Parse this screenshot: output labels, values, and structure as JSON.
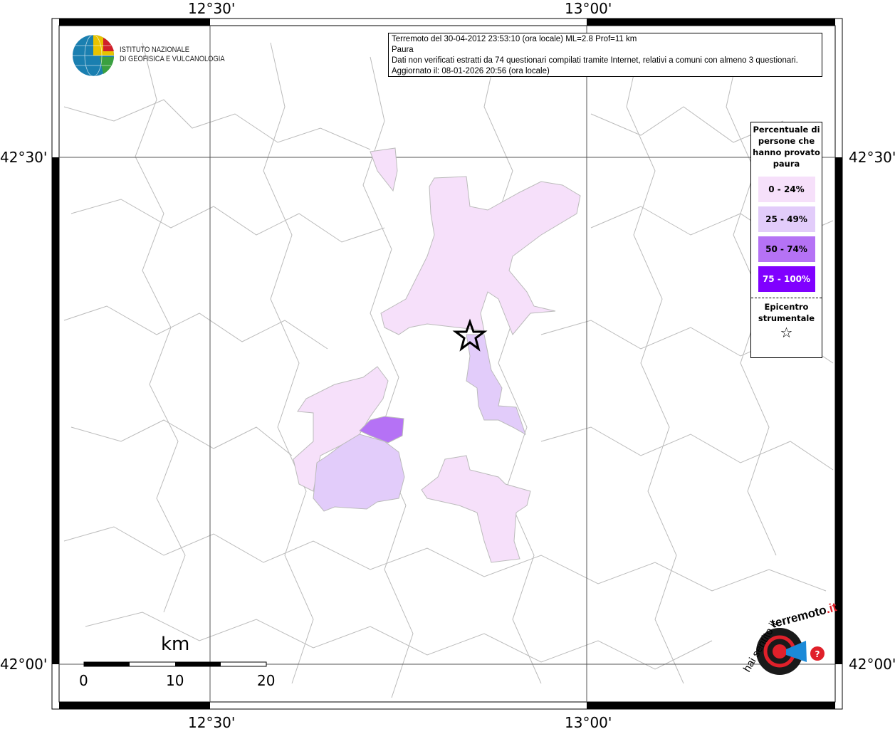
{
  "info": {
    "line1": "Terremoto del 30-04-2012 23:53:10 (ora locale) ML=2.8 Prof=11 km",
    "line2": "Paura",
    "line3": "Dati non verificati estratti da 74 questionari compilati tramite Internet, relativi a comuni con almeno 3 questionari.",
    "line4": "Aggiornato il: 08-01-2026 20:56 (ora locale)"
  },
  "logo": {
    "line1": "ISTITUTO NAZIONALE",
    "line2": "DI GEOFISICA E VULCANOLOGIA"
  },
  "axes": {
    "top": [
      "12°30'",
      "13°00'"
    ],
    "bottom": [
      "12°30'",
      "13°00'"
    ],
    "left": [
      "42°30'",
      "42°00'"
    ],
    "right": [
      "42°30'",
      "42°00'"
    ]
  },
  "legend": {
    "title": "Percentuale di persone che hanno provato paura",
    "classes": [
      {
        "label": "0 - 24%",
        "color": "#f6e0fa"
      },
      {
        "label": "25 - 49%",
        "color": "#e2ccfa"
      },
      {
        "label": "50 - 74%",
        "color": "#b572f5"
      },
      {
        "label": "75 - 100%",
        "color": "#8000ff"
      }
    ],
    "epicenter_label": "Epicentro strumentale",
    "epicenter_symbol": "☆"
  },
  "scale": {
    "unit": "km",
    "labels": [
      "0",
      "10",
      "20"
    ]
  },
  "brand_logo": "www.haisentitoilterremoto.it"
}
